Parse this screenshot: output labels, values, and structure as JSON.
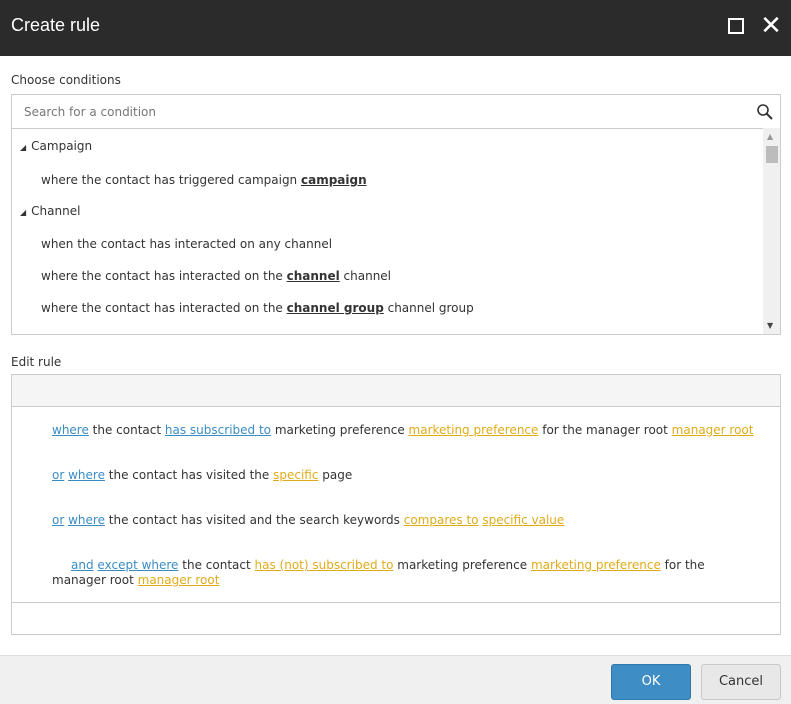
{
  "dialog": {
    "title": "Create rule",
    "maximize_icon": "maximize-icon",
    "close_icon": "close-icon",
    "close_glyph": "✕"
  },
  "conditions": {
    "label": "Choose conditions",
    "search_placeholder": "Search for a condition",
    "groups": [
      {
        "name": "Campaign",
        "items": [
          [
            {
              "t": "where the contact has triggered campaign ",
              "b": false
            },
            {
              "t": "campaign",
              "b": true
            }
          ]
        ]
      },
      {
        "name": "Channel",
        "items": [
          [
            {
              "t": "when the contact has interacted on any channel",
              "b": false
            }
          ],
          [
            {
              "t": "where the contact has interacted on the ",
              "b": false
            },
            {
              "t": "channel",
              "b": true
            },
            {
              "t": " channel",
              "b": false
            }
          ],
          [
            {
              "t": "where the contact has interacted on the ",
              "b": false
            },
            {
              "t": "channel group",
              "b": true
            },
            {
              "t": " channel group",
              "b": false
            }
          ]
        ]
      }
    ]
  },
  "edit_rule": {
    "label": "Edit rule",
    "rules": [
      [
        {
          "t": "where",
          "c": "blue"
        },
        {
          "t": " the contact ",
          "c": ""
        },
        {
          "t": "has subscribed to",
          "c": "blue"
        },
        {
          "t": " marketing preference ",
          "c": ""
        },
        {
          "t": "marketing preference",
          "c": "gold"
        },
        {
          "t": " for the manager root ",
          "c": ""
        },
        {
          "t": "manager root",
          "c": "gold"
        }
      ],
      [
        {
          "t": "or",
          "c": "blue"
        },
        {
          "t": " ",
          "c": ""
        },
        {
          "t": "where",
          "c": "blue"
        },
        {
          "t": " the contact has visited the ",
          "c": ""
        },
        {
          "t": "specific",
          "c": "gold"
        },
        {
          "t": " page",
          "c": ""
        }
      ],
      [
        {
          "t": "or",
          "c": "blue"
        },
        {
          "t": " ",
          "c": ""
        },
        {
          "t": "where",
          "c": "blue"
        },
        {
          "t": " the contact has visited and the search keywords ",
          "c": ""
        },
        {
          "t": "compares to",
          "c": "gold"
        },
        {
          "t": " ",
          "c": ""
        },
        {
          "t": "specific value",
          "c": "gold"
        }
      ],
      [
        {
          "t": "and",
          "c": "blue"
        },
        {
          "t": " ",
          "c": ""
        },
        {
          "t": "except where",
          "c": "blue"
        },
        {
          "t": " the contact ",
          "c": ""
        },
        {
          "t": "has (not) subscribed to",
          "c": "gold"
        },
        {
          "t": " marketing preference ",
          "c": ""
        },
        {
          "t": "marketing preference",
          "c": "gold"
        },
        {
          "t": " for the manager root ",
          "c": ""
        },
        {
          "t": "manager root",
          "c": "gold"
        }
      ]
    ]
  },
  "footer": {
    "ok_label": "OK",
    "cancel_label": "Cancel"
  },
  "colors": {
    "header": "#2b2b2b",
    "link_blue": "#3a8cc4",
    "link_gold": "#e0ab18",
    "ok_button": "#3e8dc4"
  }
}
